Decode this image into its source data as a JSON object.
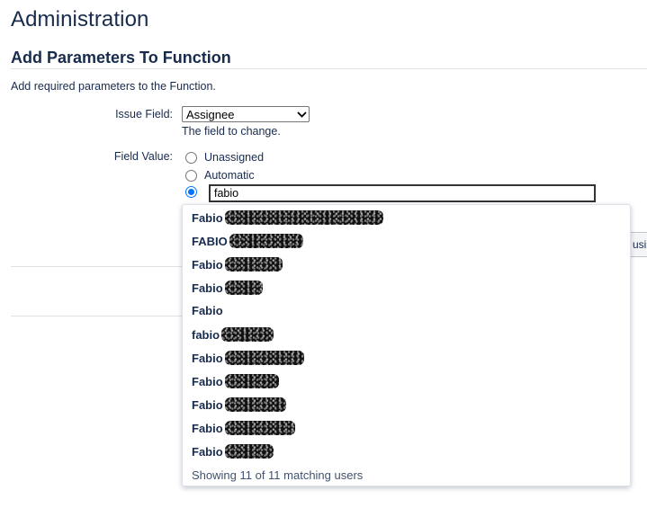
{
  "page": {
    "title": "Administration"
  },
  "section": {
    "title": "Add Parameters To Function",
    "description": "Add required parameters to the Function."
  },
  "form": {
    "issue_field": {
      "label": "Issue Field:",
      "selected": "Assignee",
      "hint": "The field to change."
    },
    "field_value": {
      "label": "Field Value:",
      "options": [
        {
          "label": "Unassigned",
          "checked": false
        },
        {
          "label": "Automatic",
          "checked": false
        },
        {
          "label": "",
          "checked": true
        }
      ],
      "user_input_value": "fabio"
    }
  },
  "dropdown": {
    "items": [
      {
        "label": "Fabio"
      },
      {
        "label": "FABIO"
      },
      {
        "label": "Fabio"
      },
      {
        "label": "Fabio"
      },
      {
        "label": "Fabio"
      },
      {
        "label": "fabio"
      },
      {
        "label": "Fabio"
      },
      {
        "label": "Fabio"
      },
      {
        "label": "Fabio"
      },
      {
        "label": "Fabio"
      },
      {
        "label": "Fabio"
      }
    ],
    "footer": "Showing 11 of 11 matching users"
  },
  "behind_button": {
    "label": "usi"
  }
}
